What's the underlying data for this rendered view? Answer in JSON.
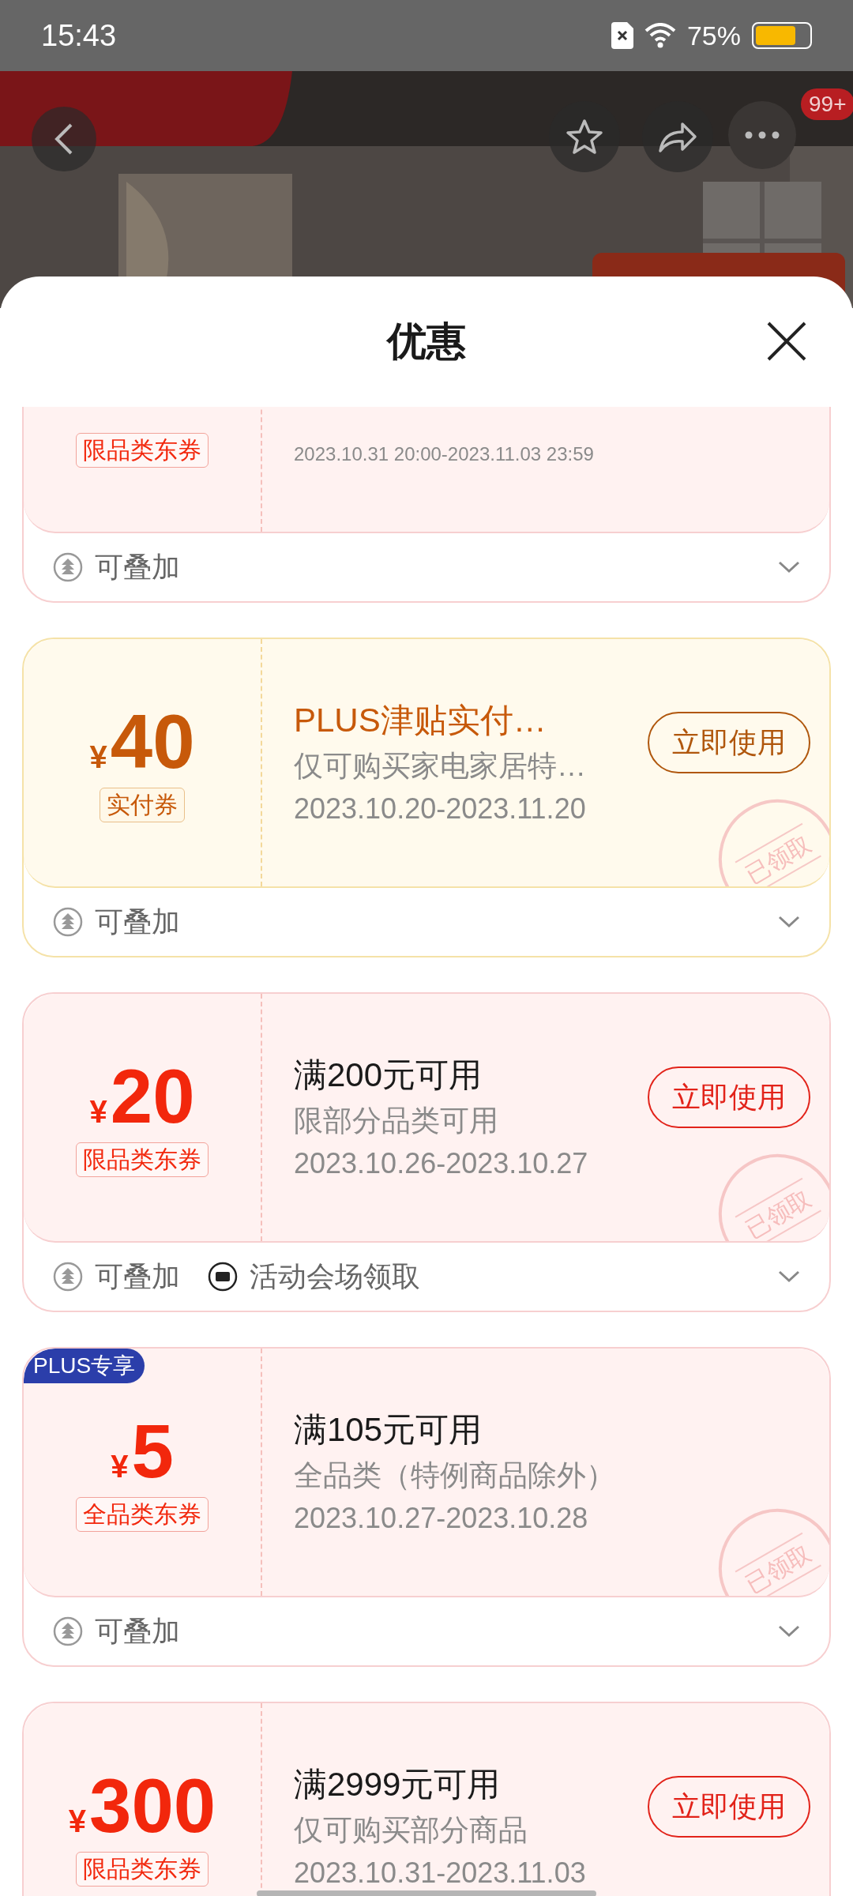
{
  "status_bar": {
    "time": "15:43",
    "battery_text": "75%"
  },
  "top_bar": {
    "badge": "99+"
  },
  "sheet": {
    "title": "优惠"
  },
  "coupons": [
    {
      "kind": "voucher",
      "tag": "限品类东券",
      "date": "2023.10.31 20:00-2023.11.03 23:59",
      "footer": [
        {
          "kind": "stack",
          "label": "可叠加"
        }
      ],
      "expanded": false
    },
    {
      "kind": "subsidy",
      "currency": "¥",
      "amount": "40",
      "tag": "实付券",
      "title": "PLUS津贴实付…",
      "subtitle": "仅可购买家电家居特…",
      "date": "2023.10.20-2023.11.20",
      "button": "立即使用",
      "stamp": "已领取",
      "footer": [
        {
          "kind": "stack",
          "label": "可叠加"
        }
      ],
      "expanded": false
    },
    {
      "kind": "voucher",
      "currency": "¥",
      "amount": "20",
      "tag": "限品类东券",
      "title": "满200元可用",
      "subtitle": "限部分品类可用",
      "date": "2023.10.26-2023.10.27",
      "button": "立即使用",
      "stamp": "已领取",
      "footer": [
        {
          "kind": "stack",
          "label": "可叠加"
        },
        {
          "kind": "venue",
          "label": "活动会场领取"
        }
      ],
      "expanded": false
    },
    {
      "kind": "voucher",
      "currency": "¥",
      "amount": "5",
      "tag": "全品类东券",
      "title": "满105元可用",
      "subtitle": "全品类（特例商品除外）",
      "date": "2023.10.27-2023.10.28",
      "stamp": "已领取",
      "plus_badge": "PLUS专享",
      "footer": [
        {
          "kind": "stack",
          "label": "可叠加"
        }
      ],
      "expanded": false
    },
    {
      "kind": "voucher",
      "currency": "¥",
      "amount": "300",
      "tag": "限品类东券",
      "title": "满2999元可用",
      "subtitle": "仅可购买部分商品",
      "date": "2023.10.31-2023.11.03",
      "button": "立即使用"
    }
  ]
}
